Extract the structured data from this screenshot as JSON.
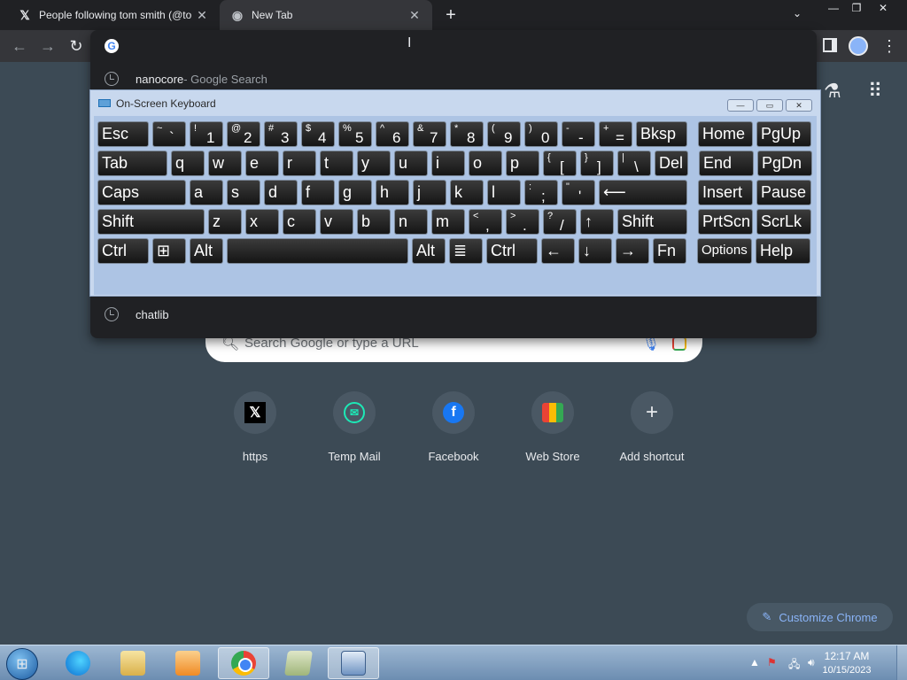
{
  "browser": {
    "tabs": [
      {
        "title": "People following tom smith (@to",
        "favicon": "x-logo-icon"
      },
      {
        "title": "New Tab",
        "favicon": "chrome-icon"
      }
    ],
    "new_tab_glyph": "+",
    "tab_close_glyph": "✕"
  },
  "omnibox": {
    "value": "",
    "suggestions": [
      {
        "strong": "nanocore",
        "muted": " - Google Search",
        "icon": "history-clock-icon"
      },
      {
        "strong": "chatlib",
        "muted": "",
        "icon": "history-clock-icon"
      }
    ]
  },
  "ntp": {
    "search_placeholder": "Search Google or type a URL",
    "shortcuts": [
      {
        "label": "https",
        "icon": "x-logo-icon"
      },
      {
        "label": "Temp Mail",
        "icon": "temp-mail-icon"
      },
      {
        "label": "Facebook",
        "icon": "facebook-icon"
      },
      {
        "label": "Web Store",
        "icon": "web-store-icon"
      },
      {
        "label": "Add shortcut",
        "icon": "plus-icon"
      }
    ],
    "customize_label": "Customize Chrome"
  },
  "osk": {
    "title": "On-Screen Keyboard",
    "rows": [
      [
        {
          "id": "esc",
          "main": "Esc",
          "w": 58
        },
        {
          "id": "tilde",
          "sym": "~",
          "low": "`",
          "w": 38
        },
        {
          "id": "1",
          "sym": "!",
          "low": "1",
          "w": 38
        },
        {
          "id": "2",
          "sym": "@",
          "low": "2",
          "w": 38
        },
        {
          "id": "3",
          "sym": "#",
          "low": "3",
          "w": 38
        },
        {
          "id": "4",
          "sym": "$",
          "low": "4",
          "w": 38
        },
        {
          "id": "5",
          "sym": "%",
          "low": "5",
          "w": 38
        },
        {
          "id": "6",
          "sym": "^",
          "low": "6",
          "w": 38
        },
        {
          "id": "7",
          "sym": "&",
          "low": "7",
          "w": 38
        },
        {
          "id": "8",
          "sym": "*",
          "low": "8",
          "w": 38
        },
        {
          "id": "9",
          "sym": "(",
          "low": "9",
          "w": 38
        },
        {
          "id": "0",
          "sym": ")",
          "low": "0",
          "w": 38
        },
        {
          "id": "minus",
          "sym": "-",
          "low": "-",
          "w": 38
        },
        {
          "id": "equals",
          "sym": "+",
          "low": "=",
          "w": 38
        },
        {
          "id": "bksp",
          "main": "Bksp",
          "w": 58
        },
        {
          "id": "home",
          "main": "Home",
          "w": 62,
          "gap": 8
        },
        {
          "id": "pgup",
          "main": "PgUp",
          "w": 62
        }
      ],
      [
        {
          "id": "tab",
          "main": "Tab",
          "w": 79
        },
        {
          "id": "q",
          "main": "q",
          "w": 38
        },
        {
          "id": "w",
          "main": "w",
          "w": 38
        },
        {
          "id": "e",
          "main": "e",
          "w": 38
        },
        {
          "id": "r",
          "main": "r",
          "w": 38
        },
        {
          "id": "t",
          "main": "t",
          "w": 38
        },
        {
          "id": "y",
          "main": "y",
          "w": 38
        },
        {
          "id": "u",
          "main": "u",
          "w": 38
        },
        {
          "id": "i",
          "main": "i",
          "w": 38
        },
        {
          "id": "o",
          "main": "o",
          "w": 38
        },
        {
          "id": "p",
          "main": "p",
          "w": 38
        },
        {
          "id": "lbracket",
          "sym": "{",
          "low": "[",
          "w": 38
        },
        {
          "id": "rbracket",
          "sym": "}",
          "low": "]",
          "w": 38
        },
        {
          "id": "backslash",
          "sym": "|",
          "low": "\\",
          "w": 38
        },
        {
          "id": "del",
          "main": "Del",
          "w": 38
        },
        {
          "id": "end",
          "main": "End",
          "w": 62,
          "gap": 8
        },
        {
          "id": "pgdn",
          "main": "PgDn",
          "w": 62
        }
      ],
      [
        {
          "id": "caps",
          "main": "Caps",
          "w": 100
        },
        {
          "id": "a",
          "main": "a",
          "w": 38
        },
        {
          "id": "s",
          "main": "s",
          "w": 38
        },
        {
          "id": "d",
          "main": "d",
          "w": 38
        },
        {
          "id": "f",
          "main": "f",
          "w": 38
        },
        {
          "id": "g",
          "main": "g",
          "w": 38
        },
        {
          "id": "h",
          "main": "h",
          "w": 38
        },
        {
          "id": "j",
          "main": "j",
          "w": 38
        },
        {
          "id": "k",
          "main": "k",
          "w": 38
        },
        {
          "id": "l",
          "main": "l",
          "w": 38
        },
        {
          "id": "semicolon",
          "sym": ":",
          "low": ";",
          "w": 38
        },
        {
          "id": "quote",
          "sym": "\"",
          "low": "'",
          "w": 38
        },
        {
          "id": "enter",
          "main": "⟵",
          "w": 100
        },
        {
          "id": "insert",
          "main": "Insert",
          "w": 62,
          "gap": 8
        },
        {
          "id": "pause",
          "main": "Pause",
          "w": 62
        }
      ],
      [
        {
          "id": "lshift",
          "main": "Shift",
          "w": 121
        },
        {
          "id": "z",
          "main": "z",
          "w": 38
        },
        {
          "id": "x",
          "main": "x",
          "w": 38
        },
        {
          "id": "c",
          "main": "c",
          "w": 38
        },
        {
          "id": "v",
          "main": "v",
          "w": 38
        },
        {
          "id": "b",
          "main": "b",
          "w": 38
        },
        {
          "id": "n",
          "main": "n",
          "w": 38
        },
        {
          "id": "m",
          "main": "m",
          "w": 38
        },
        {
          "id": "comma",
          "sym": "<",
          "low": ",",
          "w": 38
        },
        {
          "id": "period",
          "sym": ">",
          "low": ".",
          "w": 38
        },
        {
          "id": "slash",
          "sym": "?",
          "low": "/",
          "w": 38
        },
        {
          "id": "up",
          "main": "↑",
          "w": 38
        },
        {
          "id": "rshift",
          "main": "Shift",
          "w": 79
        },
        {
          "id": "prtscn",
          "main": "PrtScn",
          "w": 62,
          "gap": 8
        },
        {
          "id": "scrlk",
          "main": "ScrLk",
          "w": 62
        }
      ],
      [
        {
          "id": "lctrl",
          "main": "Ctrl",
          "w": 58
        },
        {
          "id": "win",
          "main": "⊞",
          "w": 38
        },
        {
          "id": "lalt",
          "main": "Alt",
          "w": 38
        },
        {
          "id": "space",
          "main": "",
          "w": 205
        },
        {
          "id": "ralt",
          "main": "Alt",
          "w": 38
        },
        {
          "id": "menu",
          "main": "≣",
          "w": 38
        },
        {
          "id": "rctrl",
          "main": "Ctrl",
          "w": 58
        },
        {
          "id": "left",
          "main": "←",
          "w": 38
        },
        {
          "id": "down",
          "main": "↓",
          "w": 38
        },
        {
          "id": "right",
          "main": "→",
          "w": 38
        },
        {
          "id": "fn",
          "main": "Fn",
          "w": 38
        },
        {
          "id": "options",
          "main": "Options",
          "w": 62,
          "gap": 8,
          "small": true
        },
        {
          "id": "help",
          "main": "Help",
          "w": 62
        }
      ]
    ]
  },
  "taskbar": {
    "items": [
      {
        "id": "edge",
        "icon": "edge-icon"
      },
      {
        "id": "explorer",
        "icon": "file-explorer-icon"
      },
      {
        "id": "media",
        "icon": "media-player-icon"
      },
      {
        "id": "chrome",
        "icon": "chrome-icon",
        "active": true
      },
      {
        "id": "notes",
        "icon": "sticky-notes-icon"
      },
      {
        "id": "osk",
        "icon": "on-screen-keyboard-icon",
        "active": true
      }
    ],
    "time": "12:17 AM",
    "date": "10/15/2023"
  }
}
